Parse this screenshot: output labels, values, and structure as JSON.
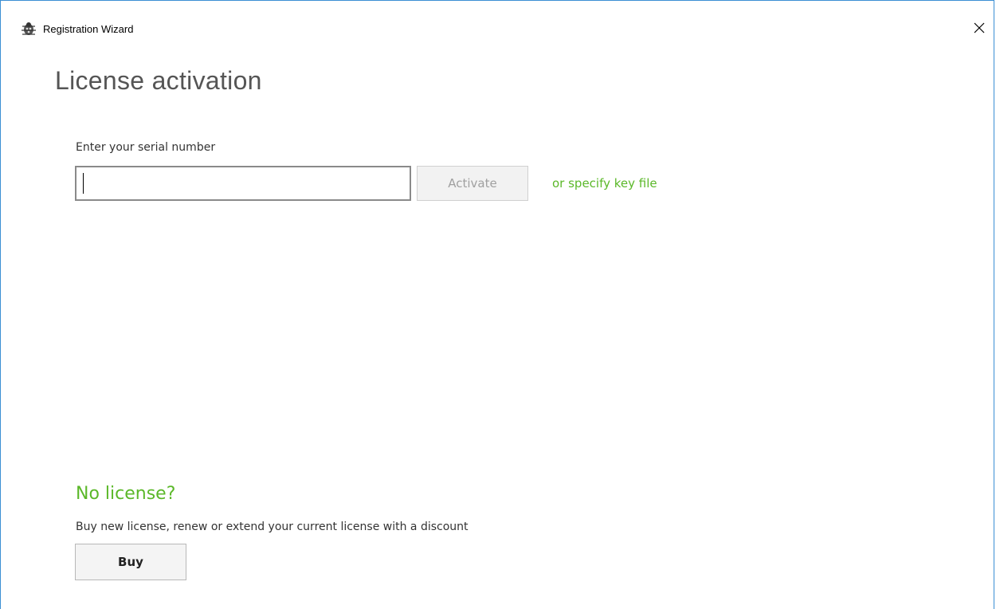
{
  "window": {
    "title": "Registration Wizard",
    "app_icon": "bug-icon",
    "close_icon": "close-icon"
  },
  "main": {
    "heading": "License activation",
    "serial": {
      "label": "Enter your serial number",
      "value": "",
      "placeholder": ""
    },
    "activate_label": "Activate",
    "keyfile_link": "or specify key file"
  },
  "no_license": {
    "heading": "No license?",
    "description": "Buy new license, renew or extend your current license with a discount",
    "buy_label": "Buy"
  },
  "colors": {
    "accent_green": "#5bb829",
    "window_border": "#3b8fd4",
    "disabled_text": "#a0a0a0"
  }
}
